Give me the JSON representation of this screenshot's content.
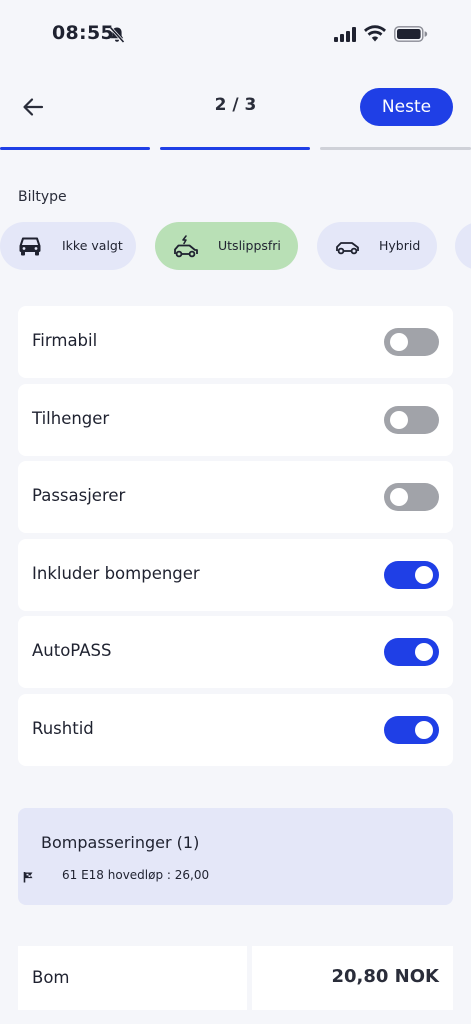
{
  "status_bar": {
    "time": "08:55",
    "icons": [
      "bell-slash-icon",
      "signal-icon",
      "wifi-icon",
      "battery-icon"
    ]
  },
  "header": {
    "back_icon": "arrow-left-icon",
    "step": "2 / 3",
    "next_label": "Neste"
  },
  "progress": {
    "current_step": 2,
    "total_steps": 3
  },
  "car_type": {
    "label": "Biltype",
    "options": [
      {
        "label": "Ikke valgt",
        "icon": "car-front-icon",
        "selected": false
      },
      {
        "label": "Utslippsfri",
        "icon": "electric-car-icon",
        "selected": true
      },
      {
        "label": "Hybrid",
        "icon": "car-side-icon",
        "selected": false
      }
    ]
  },
  "toggles": [
    {
      "label": "Firmabil",
      "on": false
    },
    {
      "label": "Tilhenger",
      "on": false
    },
    {
      "label": "Passasjerer",
      "on": false
    },
    {
      "label": "Inkluder bompenger",
      "on": true
    },
    {
      "label": "AutoPASS",
      "on": true
    },
    {
      "label": "Rushtid",
      "on": true
    }
  ],
  "toll_passages": {
    "title": "Bompasseringer (1)",
    "icon": "flag-icon",
    "entries": [
      "61 E18 hovedløp : 26,00"
    ]
  },
  "total": {
    "label": "Bom",
    "value": "20,80 NOK"
  },
  "colors": {
    "accent": "#1f3fe6",
    "selected_chip": "#b9e0b6",
    "chip": "#e4e7f8",
    "switch_off": "#a1a3a9",
    "background": "#f5f6fa"
  }
}
